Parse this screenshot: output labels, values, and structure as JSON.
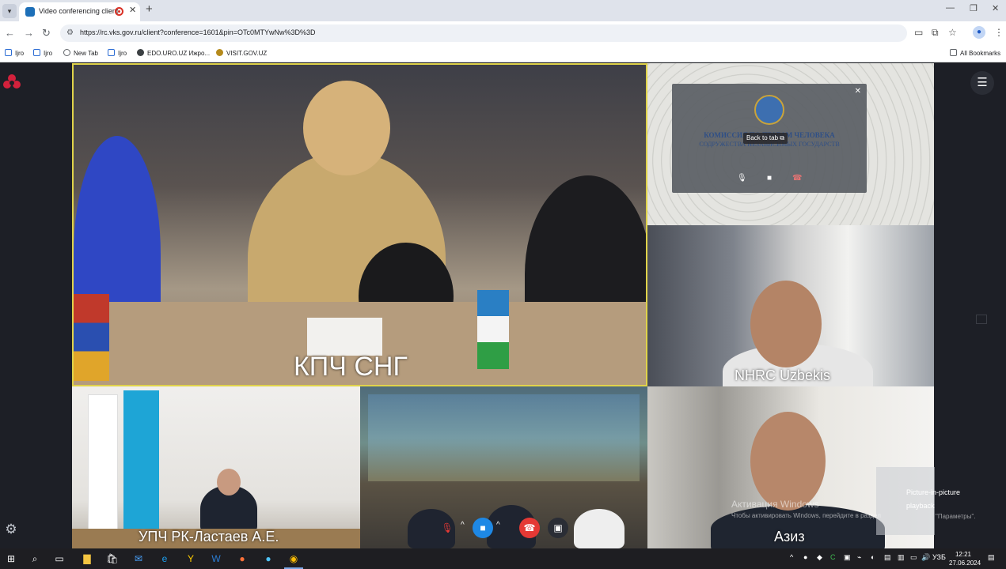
{
  "browser": {
    "tab_title": "Video conferencing client",
    "new_tab_symbol": "+",
    "tab_close_symbol": "✕",
    "url": "https://rc.vks.gov.ru/client?conference=1601&pin=OTc0MTYwNw%3D%3D",
    "bookmarks": [
      {
        "label": "Ijro",
        "icon": "ijro-icon",
        "color": "#2b6cd4"
      },
      {
        "label": "Ijro",
        "icon": "ijro-icon",
        "color": "#2b6cd4"
      },
      {
        "label": "New Tab",
        "icon": "globe-icon",
        "color": "#5f6368"
      },
      {
        "label": "Ijro",
        "icon": "ijro-icon",
        "color": "#2b6cd4"
      },
      {
        "label": "EDO.URO.UZ Ижро...",
        "icon": "info-icon",
        "color": "#3c4043"
      },
      {
        "label": "VISIT.GOV.UZ",
        "icon": "globe-icon",
        "color": "#b58a1c"
      }
    ],
    "all_bookmarks": "All Bookmarks"
  },
  "conference": {
    "main_label": "КПЧ СНГ",
    "tiles": {
      "uzbekistan": "NHRC Uzbekis",
      "rk": "УПЧ РК-Ластаев А.Е.",
      "aziz": "Азиз"
    },
    "pip_dialog": {
      "close": "✕",
      "title": "КОМИССИЯ ПО ПРАВАМ ЧЕЛОВЕКА",
      "subtitle": "СОДРУЖЕСТВА НЕЗАВИСИМЫХ ГОСУДАРСТВ",
      "back_to_tab": "Back to tab"
    },
    "picture_in_picture": "Picture-in-picture playback",
    "watermark_title": "Активация Windows",
    "watermark_sub": "Чтобы активировать Windows, перейдите в раздел",
    "watermark_end": "\"Параметры\"."
  },
  "colors": {
    "active_speaker_border": "#e0d34a",
    "hangup": "#e53935",
    "camera": "#1e88e5",
    "brand": "#d3213c"
  },
  "taskbar": {
    "time": "12:21",
    "date": "27.06.2024",
    "lang": "УЗБ"
  }
}
